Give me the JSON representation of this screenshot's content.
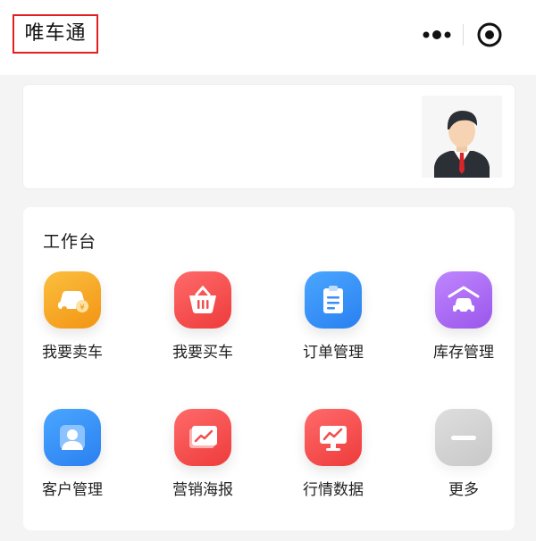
{
  "header": {
    "title": "唯车通",
    "more_icon": "more-dots-icon",
    "close_icon": "target-circle-icon"
  },
  "profile": {
    "avatar_icon": "businessman-avatar"
  },
  "workbench": {
    "title": "工作台",
    "items": [
      {
        "label": "我要卖车",
        "icon": "car-sell-icon",
        "color": "#f7a21b"
      },
      {
        "label": "我要买车",
        "icon": "basket-icon",
        "color": "#f44848"
      },
      {
        "label": "订单管理",
        "icon": "clipboard-icon",
        "color": "#2f8ef8"
      },
      {
        "label": "库存管理",
        "icon": "garage-car-icon",
        "color": "#a868f0"
      },
      {
        "label": "客户管理",
        "icon": "customer-icon",
        "color": "#2f8ef8"
      },
      {
        "label": "营销海报",
        "icon": "poster-chart-icon",
        "color": "#f44848"
      },
      {
        "label": "行情数据",
        "icon": "market-monitor-icon",
        "color": "#f44848"
      },
      {
        "label": "更多",
        "icon": "minus-more-icon",
        "color": "#d0d0d0"
      }
    ]
  }
}
